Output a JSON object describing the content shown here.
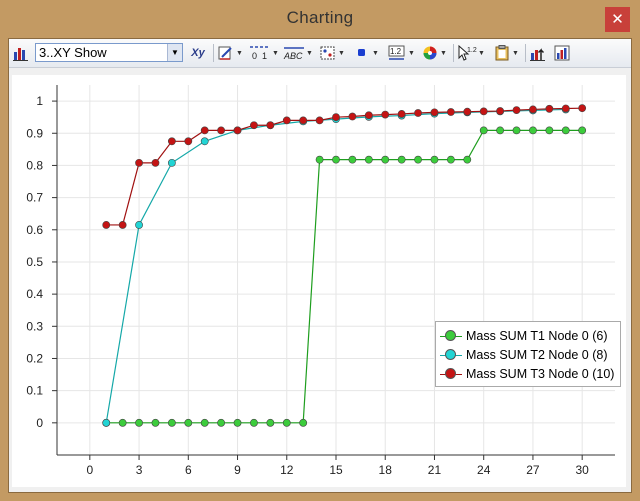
{
  "window": {
    "title": "Charting",
    "close_label": "✕"
  },
  "toolbar": {
    "chart_selector_value": "3..XY Show",
    "buttons": [
      {
        "name": "chart-type-icon",
        "glyph": "▮▮"
      },
      {
        "name": "xy-icon",
        "glyph": "Xy"
      },
      {
        "name": "edit-series-icon",
        "glyph": "✎"
      },
      {
        "name": "axis-scale-icon",
        "glyph": "01"
      },
      {
        "name": "labels-icon",
        "glyph": "ABC"
      },
      {
        "name": "markers-icon",
        "glyph": "⊡"
      },
      {
        "name": "point-style-icon",
        "glyph": "■"
      },
      {
        "name": "decimal-icon",
        "glyph": "1.2"
      },
      {
        "name": "color-palette-icon",
        "glyph": "◕"
      },
      {
        "name": "cursor-value-icon",
        "glyph": "↖"
      },
      {
        "name": "clipboard-icon",
        "glyph": "📋"
      },
      {
        "name": "export-chart-icon",
        "glyph": "▲"
      },
      {
        "name": "chart-settings-icon",
        "glyph": "▦"
      }
    ]
  },
  "chart_data": {
    "type": "line",
    "x_ticks": [
      0,
      3,
      6,
      9,
      12,
      15,
      18,
      21,
      24,
      27,
      30
    ],
    "y_ticks": [
      0,
      0.1,
      0.2,
      0.3,
      0.4,
      0.5,
      0.6,
      0.7,
      0.8,
      0.9,
      1
    ],
    "xlim": [
      -2,
      32
    ],
    "ylim": [
      -0.1,
      1.05
    ],
    "grid": true,
    "legend_position": "right",
    "series": [
      {
        "name": "Mass SUM T1 Node 0 (6)",
        "color": "#1e9e1e",
        "marker_color": "#3ccc3c",
        "x": [
          1,
          2,
          3,
          4,
          5,
          6,
          7,
          8,
          9,
          10,
          11,
          12,
          13,
          14,
          15,
          16,
          17,
          18,
          19,
          20,
          21,
          22,
          23,
          24,
          25,
          26,
          27,
          28,
          29,
          30
        ],
        "y": [
          0,
          0,
          0,
          0,
          0,
          0,
          0,
          0,
          0,
          0,
          0,
          0,
          0,
          0.818,
          0.818,
          0.818,
          0.818,
          0.818,
          0.818,
          0.818,
          0.818,
          0.818,
          0.818,
          0.909,
          0.909,
          0.909,
          0.909,
          0.909,
          0.909,
          0.909
        ]
      },
      {
        "name": "Mass SUM T2 Node 0 (8)",
        "color": "#14a8a8",
        "marker_color": "#22d4d4",
        "x": [
          1,
          3,
          5,
          7,
          9,
          11,
          13,
          15,
          17,
          19,
          21,
          23,
          25,
          27,
          29
        ],
        "y": [
          0,
          0.615,
          0.808,
          0.875,
          0.909,
          0.925,
          0.937,
          0.944,
          0.951,
          0.955,
          0.961,
          0.965,
          0.968,
          0.971,
          0.974
        ]
      },
      {
        "name": "Mass SUM T3 Node 0 (10)",
        "color": "#a01010",
        "marker_color": "#c41414",
        "x": [
          1,
          2,
          3,
          4,
          5,
          6,
          7,
          8,
          9,
          10,
          11,
          12,
          13,
          14,
          15,
          16,
          17,
          18,
          19,
          20,
          21,
          22,
          23,
          24,
          25,
          26,
          27,
          28,
          29,
          30
        ],
        "y": [
          0.615,
          0.615,
          0.808,
          0.808,
          0.875,
          0.875,
          0.909,
          0.909,
          0.909,
          0.925,
          0.925,
          0.94,
          0.94,
          0.94,
          0.95,
          0.952,
          0.956,
          0.958,
          0.96,
          0.963,
          0.965,
          0.966,
          0.967,
          0.968,
          0.969,
          0.972,
          0.974,
          0.976,
          0.977,
          0.978
        ]
      }
    ]
  }
}
